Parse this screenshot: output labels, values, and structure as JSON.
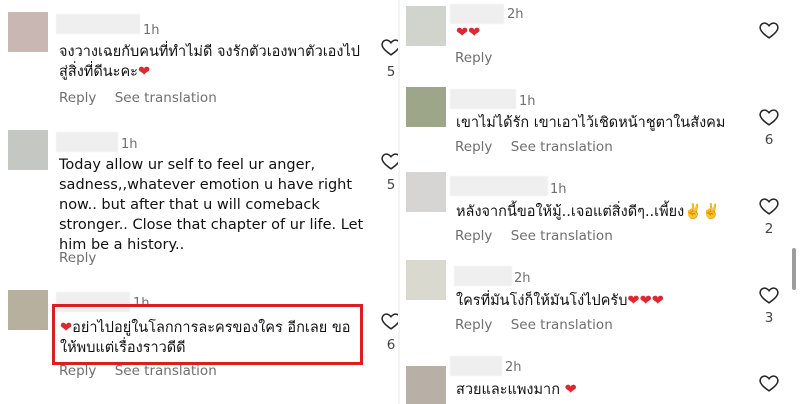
{
  "left": {
    "comments": [
      {
        "time": "1h",
        "text": "จงวางเฉยกับคนที่ทำไม่ดี จงรักตัวเองพาตัวเองไป\nสู่สิ่งที่ดีนะคะ❤️",
        "reply": "Reply",
        "translate": "See translation",
        "likes": "5",
        "avatar_color": "#c9b7b4"
      },
      {
        "time": "1h",
        "text": "Today allow ur self to feel ur anger,\nsadness,,whatever emotion u have right\nnow.. but after that u will comeback\nstronger.. Close that chapter of ur life. Let\nhim be a history..",
        "reply": "Reply",
        "translate": "",
        "likes": "5",
        "avatar_color": "#c5c7c2"
      },
      {
        "time": "1h",
        "text": "❤️อย่าไปอยู่ในโลกการละครของใคร อีกเลย ขอ\nให้พบแต่เรื่องราวดีดี",
        "reply": "Reply",
        "translate": "See translation",
        "likes": "6",
        "avatar_color": "#b7b09f"
      }
    ]
  },
  "right": {
    "comments": [
      {
        "time": "2h",
        "text": "❤️❤️",
        "reply": "Reply",
        "translate": "",
        "likes": "",
        "avatar_color": "#d0d4cc"
      },
      {
        "time": "1h",
        "text": "เขาไม่ได้รัก เขาเอาไว้เชิดหน้าชูตาในสังคม",
        "reply": "Reply",
        "translate": "See translation",
        "likes": "6",
        "avatar_color": "#9ea68a"
      },
      {
        "time": "1h",
        "text": "หลังจากนี้ขอให้มู้..เจอแต่สิ่งดีๆ..เพี้ยง✌️✌️",
        "reply": "Reply",
        "translate": "See translation",
        "likes": "2",
        "avatar_color": "#d6d5d3"
      },
      {
        "time": "2h",
        "text": "ใครที่มันโง่ก็ให้มันโง่ไปครับ❤️❤️❤️",
        "reply": "Reply",
        "translate": "See translation",
        "likes": "3",
        "avatar_color": "#dad9cf"
      },
      {
        "time": "2h",
        "text": "สวยและแพงมาก ❤️",
        "reply": "",
        "translate": "",
        "likes": "",
        "avatar_color": "#b8afa6"
      }
    ]
  },
  "colors": {
    "highlight": "#d9201f",
    "heart": "#e0262f",
    "muted": "#6f6f6f"
  }
}
